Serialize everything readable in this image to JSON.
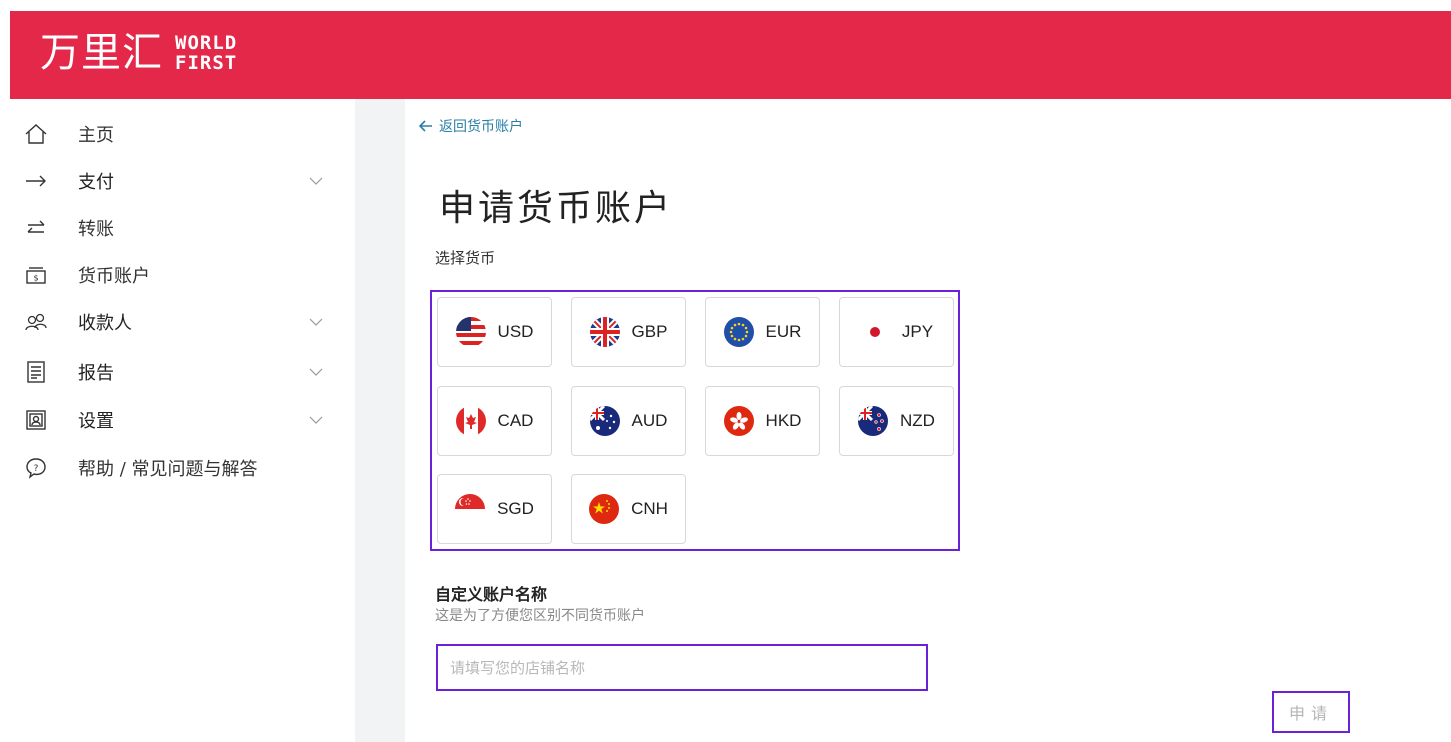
{
  "brand": {
    "name_cn": "万里汇",
    "name_en_line1": "WORLD",
    "name_en_line2": "FIRST",
    "color": "#e3284a"
  },
  "sidebar": {
    "items": [
      {
        "label": "主页",
        "icon": "home-icon",
        "has_dropdown": false
      },
      {
        "label": "支付",
        "icon": "arrow-right-icon",
        "has_dropdown": true
      },
      {
        "label": "转账",
        "icon": "transfer-arrows-icon",
        "has_dropdown": false
      },
      {
        "label": "货币账户",
        "icon": "wallet-icon",
        "has_dropdown": false
      },
      {
        "label": "收款人",
        "icon": "users-icon",
        "has_dropdown": true
      },
      {
        "label": "报告",
        "icon": "document-icon",
        "has_dropdown": true
      },
      {
        "label": "设置",
        "icon": "settings-icon",
        "has_dropdown": true
      },
      {
        "label": "帮助 / 常见问题与解答",
        "icon": "help-icon",
        "has_dropdown": false
      }
    ]
  },
  "main": {
    "back_link": "返回货币账户",
    "title": "申请货币账户",
    "currency_section_label": "选择货币",
    "currencies": [
      {
        "code": "USD",
        "flag": "us-flag-icon"
      },
      {
        "code": "GBP",
        "flag": "uk-flag-icon"
      },
      {
        "code": "EUR",
        "flag": "eu-flag-icon"
      },
      {
        "code": "JPY",
        "flag": "japan-flag-icon"
      },
      {
        "code": "CAD",
        "flag": "canada-flag-icon"
      },
      {
        "code": "AUD",
        "flag": "australia-flag-icon"
      },
      {
        "code": "HKD",
        "flag": "hongkong-flag-icon"
      },
      {
        "code": "NZD",
        "flag": "newzealand-flag-icon"
      },
      {
        "code": "SGD",
        "flag": "singapore-flag-icon"
      },
      {
        "code": "CNH",
        "flag": "china-flag-icon"
      }
    ],
    "name_field": {
      "title": "自定义账户名称",
      "description": "这是为了方便您区别不同货币账户",
      "placeholder": "请填写您的店铺名称",
      "value": ""
    },
    "apply_button": "申请"
  },
  "colors": {
    "accent_outline": "#6a22d8",
    "link": "#2a7fa6"
  }
}
